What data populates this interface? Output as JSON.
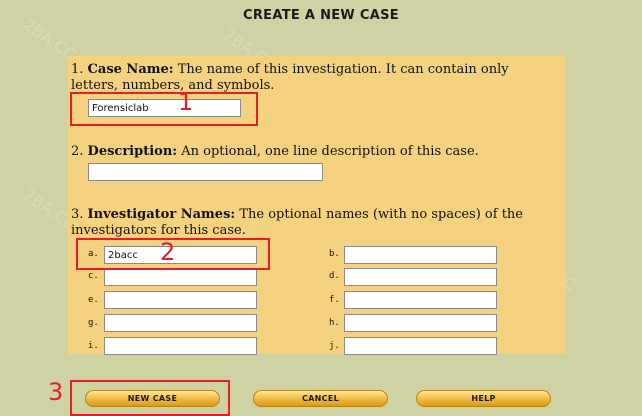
{
  "page": {
    "title": "CREATE A NEW CASE"
  },
  "case_name": {
    "number": "1.",
    "label": "Case Name:",
    "description": "The name of this investigation. It can contain only letters, numbers, and symbols.",
    "value": "Forensiclab"
  },
  "description": {
    "number": "2.",
    "label": "Description:",
    "description": "An optional, one line description of this case.",
    "value": ""
  },
  "investigators": {
    "number": "3.",
    "label": "Investigator Names:",
    "description": "The optional names (with no spaces) of the investigators for this case.",
    "fields": [
      {
        "key": "a.",
        "value": "2bacc"
      },
      {
        "key": "b.",
        "value": ""
      },
      {
        "key": "c.",
        "value": ""
      },
      {
        "key": "d.",
        "value": ""
      },
      {
        "key": "e.",
        "value": ""
      },
      {
        "key": "f.",
        "value": ""
      },
      {
        "key": "g.",
        "value": ""
      },
      {
        "key": "h.",
        "value": ""
      },
      {
        "key": "i.",
        "value": ""
      },
      {
        "key": "j.",
        "value": ""
      }
    ]
  },
  "buttons": {
    "new_case": "NEW CASE",
    "cancel": "CANCEL",
    "help": "HELP"
  },
  "annotations": {
    "one": "1",
    "two": "2",
    "three": "3"
  },
  "watermark": "2BA.CC",
  "colors": {
    "background": "#cfd3a3",
    "panel": "#f4d27f",
    "annotation": "#e3202a",
    "button": "#f1b93b"
  }
}
